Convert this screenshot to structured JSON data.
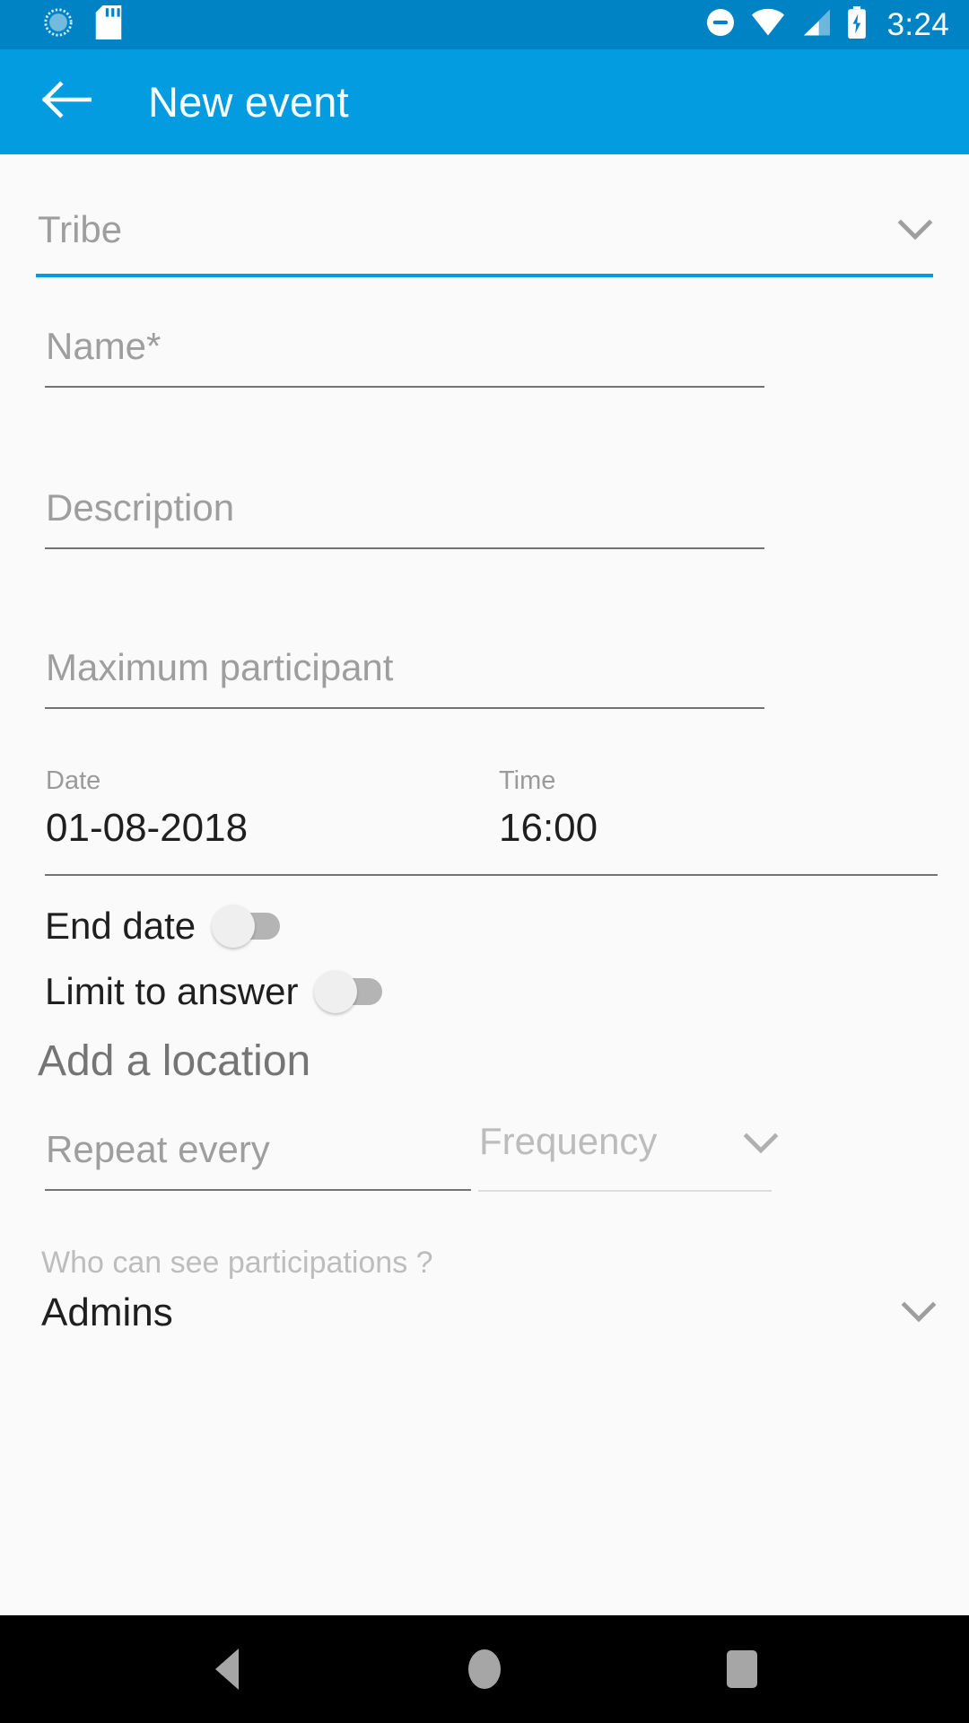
{
  "status_bar": {
    "left_icons": [
      "sync-circle-icon",
      "sd-card-icon"
    ],
    "right_icons": [
      "do-not-disturb-icon",
      "wifi-icon",
      "cellular-signal-icon",
      "battery-charging-icon"
    ],
    "clock": "3:24",
    "background_color": "#0083c4"
  },
  "app_bar": {
    "back_icon": "arrow-back-icon",
    "title": "New event",
    "background_color": "#039ce0"
  },
  "form": {
    "tribe": {
      "placeholder": "Tribe",
      "value": "",
      "chevron_icon": "chevron-down-icon",
      "underline_color": "#039ce0"
    },
    "name": {
      "placeholder": "Name*",
      "value": ""
    },
    "description": {
      "placeholder": "Description",
      "value": ""
    },
    "maximum_participant": {
      "placeholder": "Maximum participant",
      "value": ""
    },
    "date": {
      "label": "Date",
      "value": "01-08-2018"
    },
    "time": {
      "label": "Time",
      "value": "16:00"
    },
    "end_date_toggle": {
      "label": "End date",
      "state": "off"
    },
    "limit_to_answer_toggle": {
      "label": "Limit to answer",
      "state": "off"
    },
    "add_location": {
      "label": "Add a location"
    },
    "repeat_every": {
      "placeholder": "Repeat every",
      "value": ""
    },
    "frequency": {
      "placeholder": "Frequency",
      "value": "",
      "chevron_icon": "chevron-down-icon"
    },
    "visibility": {
      "label": "Who can see participations ?",
      "value": "Admins",
      "chevron_icon": "chevron-down-icon"
    }
  },
  "nav_bar": {
    "back_icon": "nav-back-triangle-icon",
    "home_icon": "nav-home-circle-icon",
    "recents_icon": "nav-recents-square-icon",
    "background_color": "#000000"
  }
}
